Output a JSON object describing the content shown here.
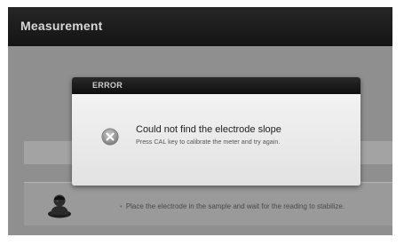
{
  "app": {
    "title": "Measurement"
  },
  "background": {
    "instruction": "Place the electrode in the sample and wait for the reading to stabilize.",
    "bullet": "•",
    "avatar_icon": "operator-icon"
  },
  "dialog": {
    "header": "ERROR",
    "icon": "close-circle-icon",
    "title": "Could not find the electrode slope",
    "message": "Press CAL key to calibrate the meter and try again."
  },
  "colors": {
    "titlebar": "#1c1c1c",
    "overlay": "#8f8f8f",
    "dialog_body": "#e9e9e9",
    "dialog_header": "#141414"
  }
}
